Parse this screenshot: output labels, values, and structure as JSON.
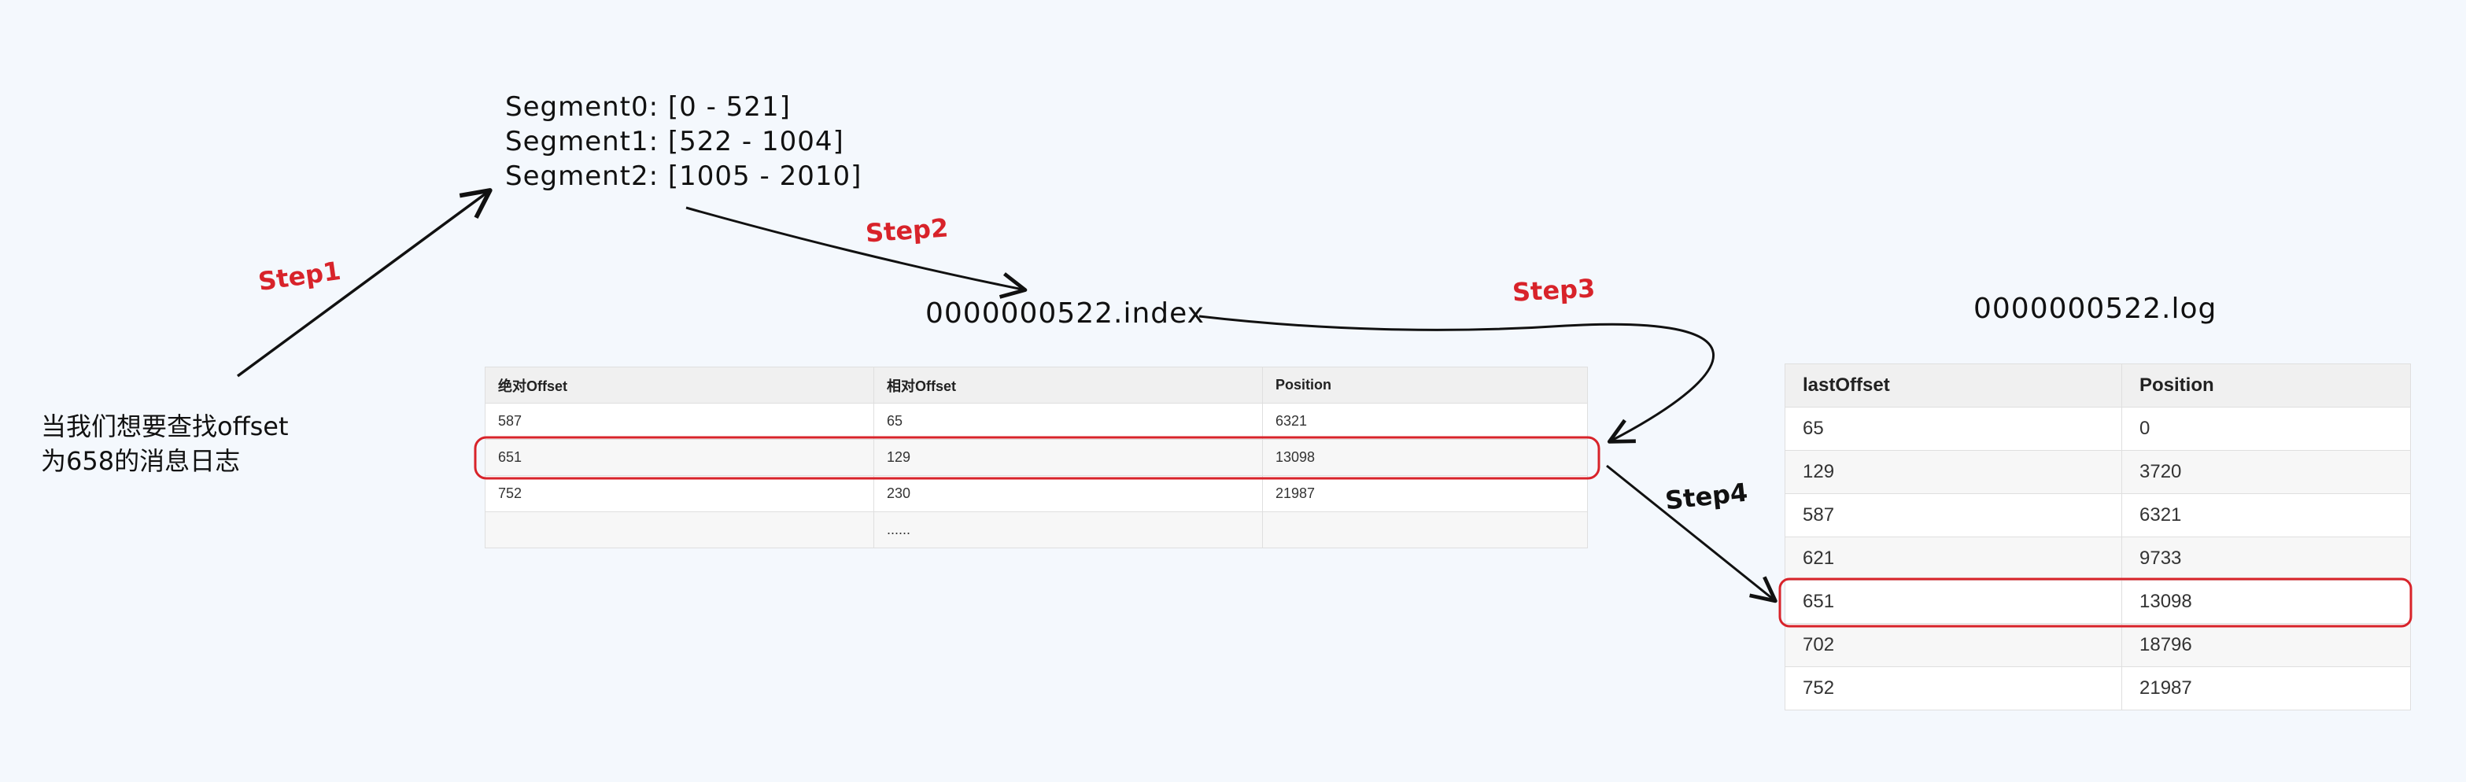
{
  "segments": [
    "Segment0: [0 - 521]",
    "Segment1:  [522 - 1004]",
    "Segment2: [1005 - 2010]"
  ],
  "steps": {
    "step1": "Step1",
    "step2": "Step2",
    "step3": "Step3",
    "step4": "Step4"
  },
  "files": {
    "index_file": "0000000522.index",
    "log_file": "0000000522.log"
  },
  "question": {
    "line1": "当我们想要查找offset",
    "line2": "为658的消息日志"
  },
  "index_table": {
    "headers": [
      "绝对Offset",
      "相对Offset",
      "Position"
    ],
    "rows": [
      [
        "587",
        "65",
        "6321"
      ],
      [
        "651",
        "129",
        "13098"
      ],
      [
        "752",
        "230",
        "21987"
      ],
      [
        "",
        "......",
        ""
      ]
    ]
  },
  "log_table": {
    "headers": [
      "lastOffset",
      "Position"
    ],
    "rows": [
      [
        "65",
        "0"
      ],
      [
        "129",
        "3720"
      ],
      [
        "587",
        "6321"
      ],
      [
        "621",
        "9733"
      ],
      [
        "651",
        "13098"
      ],
      [
        "702",
        "18796"
      ],
      [
        "752",
        "21987"
      ]
    ]
  },
  "colors": {
    "highlight": "#d8232a",
    "arrow": "#111111",
    "background": "#f4f8fd"
  }
}
